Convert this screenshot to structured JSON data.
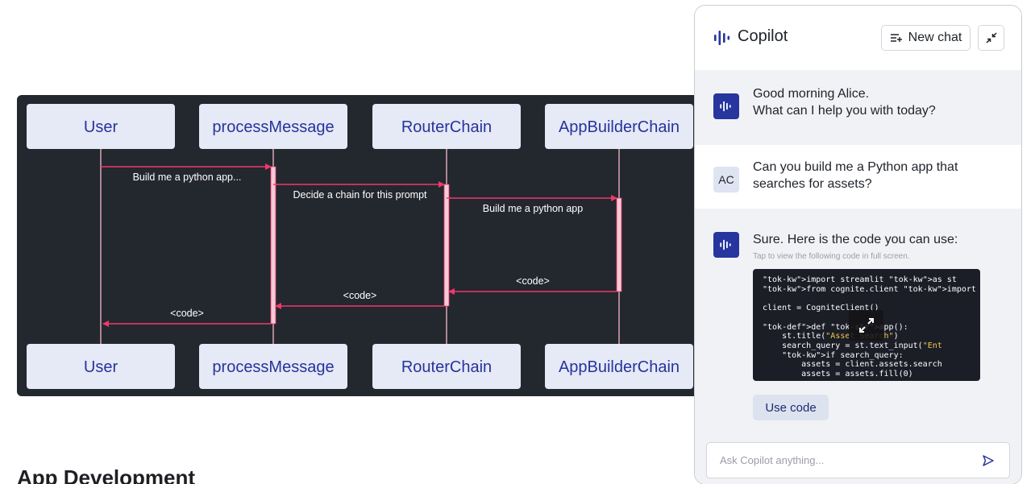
{
  "diagram": {
    "participants": [
      "User",
      "processMessage",
      "RouterChain",
      "AppBuilderChain"
    ],
    "messages": [
      {
        "from": 0,
        "to": 1,
        "label": "Build me a python app..."
      },
      {
        "from": 1,
        "to": 2,
        "label": "Decide a chain for this prompt"
      },
      {
        "from": 2,
        "to": 3,
        "label": "Build me a python app"
      },
      {
        "from": 3,
        "to": 2,
        "label": "<code>"
      },
      {
        "from": 2,
        "to": 1,
        "label": "<code>"
      },
      {
        "from": 1,
        "to": 0,
        "label": "<code>"
      }
    ],
    "colors": {
      "background": "#23272e",
      "box": "#e6e9f6",
      "box_text": "#25349c",
      "arrow": "#f0386b",
      "lifeline": "#f7b9c9",
      "label": "#ffffff"
    }
  },
  "section": {
    "heading": "App Development"
  },
  "copilot": {
    "title": "Copilot",
    "logo_icon": "soundwave-icon",
    "new_chat_label": "New chat",
    "messages": [
      {
        "role": "assistant",
        "lines": [
          "Good morning Alice.",
          "What can I help you with today?"
        ]
      },
      {
        "role": "user",
        "avatar": "AC",
        "text": "Can you build me a Python app that searches for assets?"
      },
      {
        "role": "assistant",
        "text": "Sure. Here is the code you can use:",
        "hint": "Tap to view the following code in full screen.",
        "action": "Use code"
      }
    ],
    "code_lines": [
      "import streamlit as st",
      "from cognite.client import CogniteClie",
      "",
      "client = CogniteClient()",
      "",
      "def app():",
      "    st.title(\"Asset Search\")",
      "    search_query = st.text_input(\"Ent",
      "    if search_query:",
      "        assets = client.assets.search",
      "        assets = assets.fill(0)"
    ],
    "input_placeholder": "Ask Copilot anything...",
    "colors": {
      "accent": "#27359e",
      "panel_bg": "#f1f2f5",
      "code_bg": "#1b1d27"
    }
  }
}
